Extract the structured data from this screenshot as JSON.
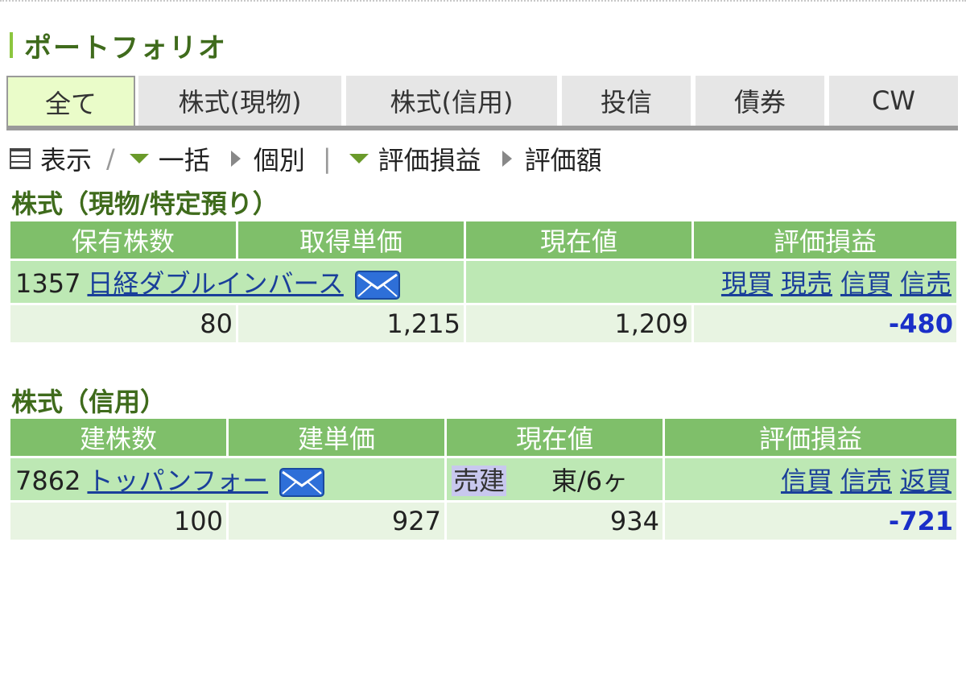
{
  "page": {
    "title": "ポートフォリオ"
  },
  "tabs": [
    {
      "label": "全て",
      "active": true
    },
    {
      "label": "株式(現物)",
      "active": false
    },
    {
      "label": "株式(信用)",
      "active": false
    },
    {
      "label": "投信",
      "active": false
    },
    {
      "label": "債券",
      "active": false
    },
    {
      "label": "CW",
      "active": false
    }
  ],
  "viewbar": {
    "display_label": "表示",
    "slash": "/",
    "bulk": "一括",
    "individual": "個別",
    "divider": "|",
    "valuation_pl": "評価損益",
    "valuation_amount": "評価額"
  },
  "spot_section": {
    "title": "株式（現物/特定預り）",
    "headers": [
      "保有株数",
      "取得単価",
      "現在値",
      "評価損益"
    ],
    "row": {
      "code": "1357",
      "name": "日経ダブルインバース",
      "actions": [
        "現買",
        "現売",
        "信買",
        "信売"
      ],
      "shares": "80",
      "avg_price": "1,215",
      "current_price": "1,209",
      "pl": "-480"
    }
  },
  "margin_section": {
    "title": "株式（信用）",
    "headers": [
      "建株数",
      "建単価",
      "現在値",
      "評価損益"
    ],
    "row": {
      "code": "7862",
      "name": "トッパンフォー",
      "position_type": "売建",
      "market_term": "東/6ヶ",
      "actions": [
        "信買",
        "信売",
        "返買"
      ],
      "shares": "100",
      "avg_price": "927",
      "current_price": "934",
      "pl": "-721"
    }
  },
  "colors": {
    "header_green": "#7fbf6a",
    "row_green": "#bde8b4",
    "nums_row": "#e8f4e2",
    "title_green": "#3f6b1c",
    "link_blue": "#1a3f9a",
    "pl_blue": "#1a2fc8"
  },
  "icons": {
    "view": "grid-icon",
    "mail": "mail-icon"
  }
}
